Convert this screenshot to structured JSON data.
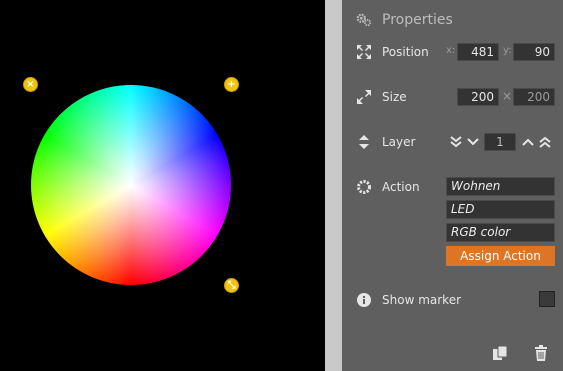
{
  "canvas": {
    "handles": {
      "remove": {
        "icon": "close-icon",
        "glyph": "×"
      },
      "add": {
        "icon": "plus-icon",
        "glyph": "+"
      },
      "resize": {
        "icon": "resize-icon",
        "glyph": "⤡"
      }
    },
    "handle_color": "#f2c40f"
  },
  "properties": {
    "title": "Properties",
    "position": {
      "label": "Position",
      "x_axis": "x:",
      "x": "481",
      "y_axis": "y:",
      "y": "90"
    },
    "size": {
      "label": "Size",
      "width": "200",
      "sep": "×",
      "height": "200"
    },
    "layer": {
      "label": "Layer",
      "value": "1"
    },
    "action": {
      "label": "Action",
      "items": [
        "Wohnen",
        "LED",
        "RGB color"
      ],
      "assign_label": "Assign Action",
      "accent": "#dd7524"
    },
    "marker": {
      "label": "Show marker",
      "checked": false
    }
  },
  "footer": {
    "copy_icon": "copy-icon",
    "delete_icon": "trash-icon"
  }
}
